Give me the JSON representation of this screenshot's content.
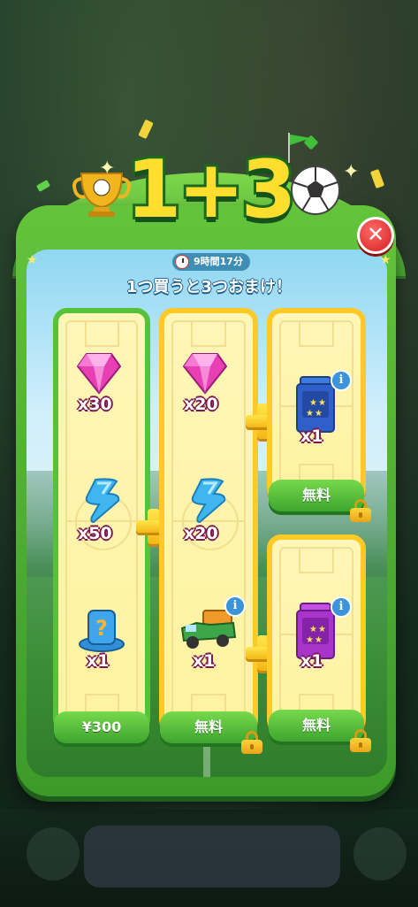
{
  "promo": {
    "title": "1+3",
    "timer": "9時間17分",
    "subtitle": "1つ買うと3つおまけ！"
  },
  "cards": [
    {
      "items": [
        {
          "icon": "gem-icon",
          "qty": "x30"
        },
        {
          "icon": "lightning-icon",
          "qty": "x50"
        },
        {
          "icon": "mystery-hat-icon",
          "qty": "x1"
        }
      ],
      "button": "¥300",
      "locked": false
    },
    {
      "items": [
        {
          "icon": "gem-icon",
          "qty": "x20"
        },
        {
          "icon": "lightning-icon",
          "qty": "x20"
        },
        {
          "icon": "truck-icon",
          "qty": "x1"
        }
      ],
      "button": "無料",
      "locked": true
    },
    {
      "items": [
        {
          "icon": "blue-card-pack-icon",
          "qty": "x1"
        }
      ],
      "button": "無料",
      "locked": true
    },
    {
      "items": [
        {
          "icon": "purple-card-pack-icon",
          "qty": "x1"
        }
      ],
      "button": "無料",
      "locked": true
    }
  ],
  "colors": {
    "frame_green": "#55c23a",
    "frame_yellow": "#ffc928",
    "title_yellow": "#ffde2e",
    "close_red": "#d51f1f"
  }
}
